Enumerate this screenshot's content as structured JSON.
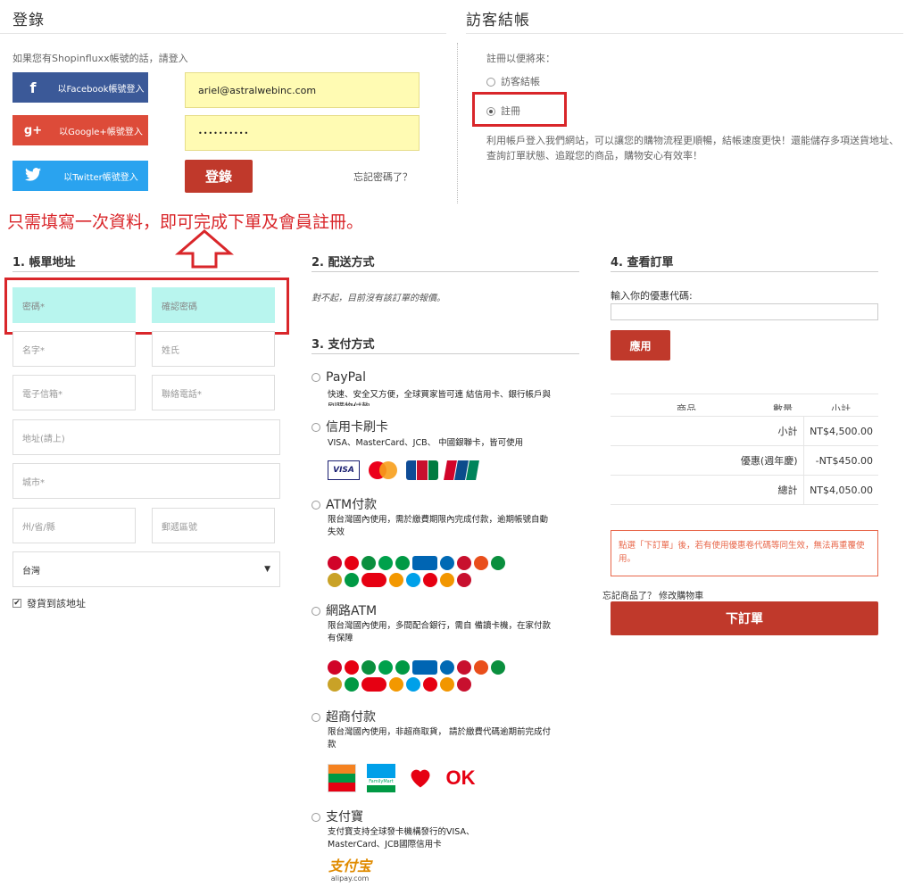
{
  "login": {
    "title": "登錄",
    "subtitle": "如果您有Shopinfluxx帳號的話，請登入",
    "facebook_label": "以Facebook帳號登入",
    "google_label": "以Google+帳號登入",
    "twitter_label": "以Twitter帳號登入",
    "email_value": "ariel@astralwebinc.com",
    "password_value": "••••••••••",
    "login_button": "登錄",
    "forgot_link": "忘記密碼了？"
  },
  "guest": {
    "title": "訪客結帳",
    "prompt": "註冊以便將來：",
    "option_guest": "訪客結帳",
    "option_register": "註冊",
    "selected": "註冊",
    "description": "利用帳戶登入我們網站，可以讓您的購物流程更順暢，結帳速度更快！還能儲存多項送貨地址、查詢訂單狀態、追蹤您的商品，購物安心有效率！"
  },
  "annotation": {
    "text": "只需填寫一次資料，即可完成下單及會員註冊。",
    "color": "#d9262a"
  },
  "billing": {
    "title": "1. 帳單地址",
    "password_placeholder": "密碼*",
    "confirm_password_placeholder": "確認密碼",
    "first_name_placeholder": "名字*",
    "last_name_placeholder": "姓氏",
    "email_placeholder": "電子信箱*",
    "phone_placeholder": "聯絡電話*",
    "address_placeholder": "地址(請上)",
    "city_placeholder": "城市*",
    "state_placeholder": "州/省/縣",
    "zip_placeholder": "郵遞區號",
    "country_value": "台灣",
    "ship_same_label": "發貨到該地址"
  },
  "shipping": {
    "title": "2. 配送方式",
    "notice": "對不起，目前沒有該訂單的報價。"
  },
  "payment": {
    "title": "3. 支付方式",
    "methods": [
      {
        "name": "PayPal",
        "desc": "快速、安全又方便，全球買家皆可連 結信用卡、銀行帳戶與刷購物付款"
      },
      {
        "name": "信用卡刷卡",
        "desc": "VISA、MasterCard、JCB、 中國銀聯卡，皆可使用"
      },
      {
        "name": "ATM付款",
        "desc": "限台灣國內使用，需於繳費期限內完成付款，逾期帳號自動失效"
      },
      {
        "name": "網路ATM",
        "desc": "限台灣國內使用，多間配合銀行，需自 備讀卡機，在家付款有保障"
      },
      {
        "name": "超商付款",
        "desc": "限台灣國內使用，非超商取貨， 請於繳費代碼逾期前完成付款"
      },
      {
        "name": "支付寶",
        "desc": "支付寶支持全球發卡機構發行的VISA、MasterCard、JCB國際信用卡"
      }
    ],
    "card_logos": [
      "VISA",
      "MasterCard",
      "JCB",
      "UnionPay"
    ],
    "store_logos": [
      "7-ELEVEN",
      "FamilyMart",
      "Hi-Life",
      "OK"
    ],
    "alipay_logo": "支付宝",
    "alipay_url_text": "alipay.com"
  },
  "review": {
    "title": "4. 查看訂單",
    "coupon_label": "輸入你的優惠代碼:",
    "apply_button": "應用",
    "headers": [
      "商品",
      "數量",
      "小計"
    ],
    "rows": [
      {
        "label": "小計",
        "value": "NT$4,500.00"
      },
      {
        "label": "優惠(週年慶)",
        "value": "-NT$450.00"
      },
      {
        "label": "總計",
        "value": "NT$4,050.00"
      }
    ],
    "warning": "點選「下訂單」後，若有使用優惠卷代碼等同生效，無法再重覆使用。",
    "forgot_text": "忘記商品了？ 修改購物車",
    "place_order_button": "下訂單"
  },
  "colors": {
    "accent_red": "#c0392b",
    "facebook": "#3b5998",
    "google": "#dd4b39",
    "twitter": "#2aa3ef",
    "input_yellow": "#fffbb3",
    "input_teal": "#b8f5ee"
  }
}
